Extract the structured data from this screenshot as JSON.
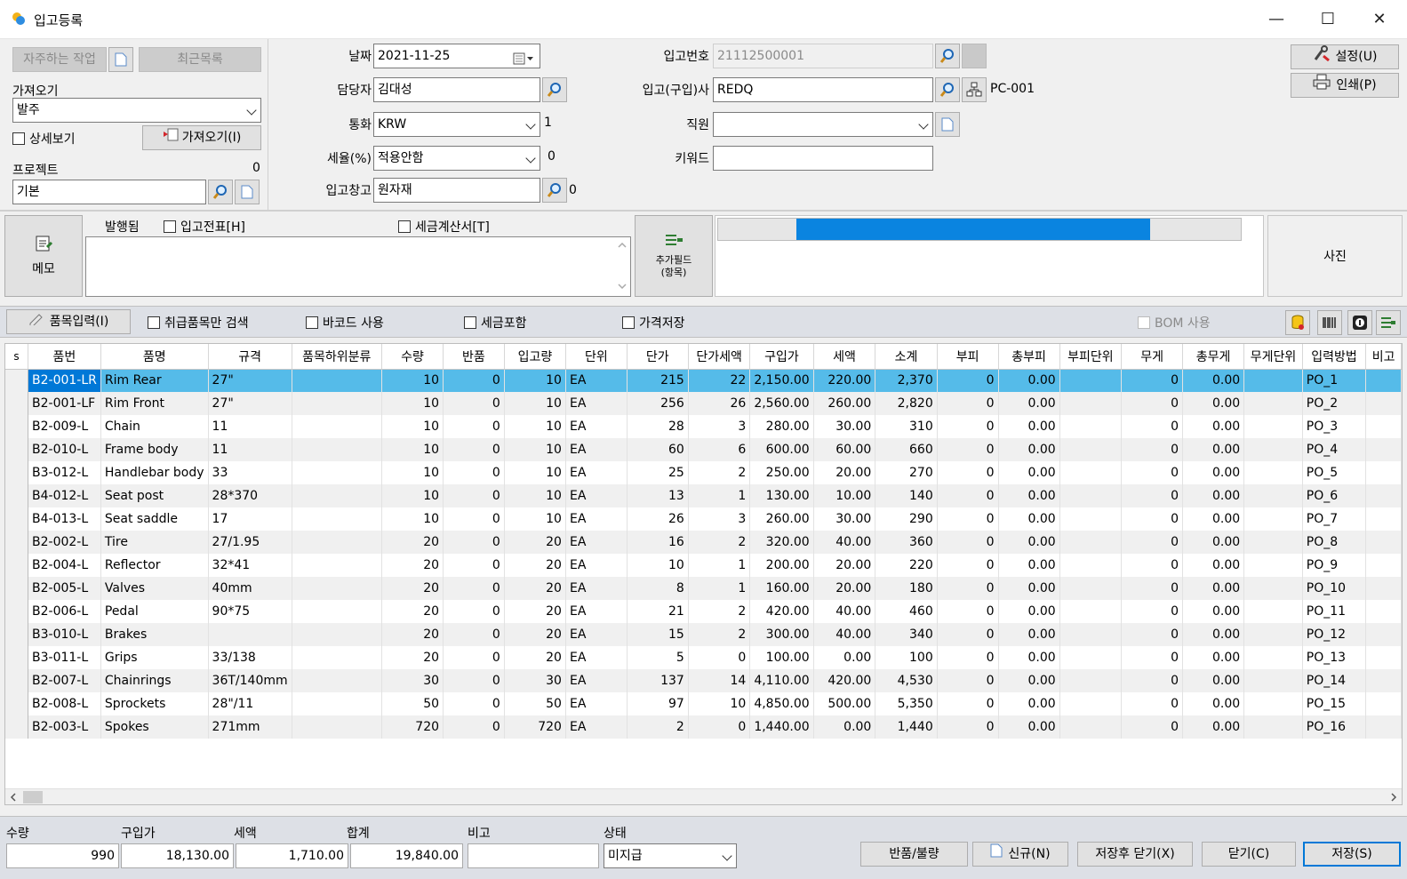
{
  "window": {
    "title": "입고등록",
    "minimize": "—",
    "maximize": "☐",
    "close": "✕"
  },
  "top_left": {
    "frequent_label": "자주하는 작업",
    "recent_label": "최근목록",
    "import_label": "가져오기",
    "import_value": "발주",
    "detail_view_label": "상세보기",
    "import_button_label": "가져오기(I)",
    "project_label": "프로젝트",
    "project_count": "0",
    "project_value": "기본"
  },
  "form": {
    "date_label": "날짜",
    "date_value": "2021-11-25",
    "manager_label": "담당자",
    "manager_value": "김대성",
    "currency_label": "통화",
    "currency_value": "KRW",
    "currency_rate": "1",
    "tax_label": "세율(%)",
    "tax_value": "적용안함",
    "tax_rate": "0",
    "warehouse_label": "입고창고",
    "warehouse_value": "원자재",
    "warehouse_count": "0",
    "receipt_no_label": "입고번호",
    "receipt_no_value": "21112500001",
    "supplier_label": "입고(구입)사",
    "supplier_value": "REDQ",
    "supplier_code": "PC-001",
    "staff_label": "직원",
    "staff_value": "",
    "keyword_label": "키워드",
    "keyword_value": ""
  },
  "right_buttons": {
    "settings_label": "설정(U)",
    "print_label": "인쇄(P)"
  },
  "memo": {
    "memo_label": "메모",
    "issued_label": "발행됨",
    "slip_label": "입고전표[H]",
    "invoice_label": "세금계산서[T]",
    "extra_field_label_1": "추가필드",
    "extra_field_label_2": "(항목)",
    "progress": 0.82,
    "photo_label": "사진"
  },
  "toolbar": {
    "item_input_label": "품목입력(I)",
    "handled_only_label": "취급품목만 검색",
    "barcode_label": "바코드 사용",
    "tax_included_label": "세금포함",
    "price_save_label": "가격저장",
    "bom_label": "BOM 사용"
  },
  "grid": {
    "columns": [
      "s",
      "품번",
      "품명",
      "규격",
      "품목하위분류",
      "수량",
      "반품",
      "입고량",
      "단위",
      "단가",
      "단가세액",
      "구입가",
      "세액",
      "소계",
      "부피",
      "총부피",
      "부피단위",
      "무게",
      "총무게",
      "무게단위",
      "입력방법",
      "비고"
    ],
    "rows": [
      [
        "B2-001-LR",
        "Rim Rear",
        "27\"",
        "",
        "10",
        "0",
        "10",
        "EA",
        "215",
        "22",
        "2,150.00",
        "220.00",
        "2,370",
        "0",
        "0.00",
        "",
        "0",
        "0.00",
        "",
        "PO_1"
      ],
      [
        "B2-001-LF",
        "Rim Front",
        "27\"",
        "",
        "10",
        "0",
        "10",
        "EA",
        "256",
        "26",
        "2,560.00",
        "260.00",
        "2,820",
        "0",
        "0.00",
        "",
        "0",
        "0.00",
        "",
        "PO_2"
      ],
      [
        "B2-009-L",
        "Chain",
        "11",
        "",
        "10",
        "0",
        "10",
        "EA",
        "28",
        "3",
        "280.00",
        "30.00",
        "310",
        "0",
        "0.00",
        "",
        "0",
        "0.00",
        "",
        "PO_3"
      ],
      [
        "B2-010-L",
        "Frame body",
        "11",
        "",
        "10",
        "0",
        "10",
        "EA",
        "60",
        "6",
        "600.00",
        "60.00",
        "660",
        "0",
        "0.00",
        "",
        "0",
        "0.00",
        "",
        "PO_4"
      ],
      [
        "B3-012-L",
        "Handlebar body",
        "33",
        "",
        "10",
        "0",
        "10",
        "EA",
        "25",
        "2",
        "250.00",
        "20.00",
        "270",
        "0",
        "0.00",
        "",
        "0",
        "0.00",
        "",
        "PO_5"
      ],
      [
        "B4-012-L",
        "Seat post",
        "28*370",
        "",
        "10",
        "0",
        "10",
        "EA",
        "13",
        "1",
        "130.00",
        "10.00",
        "140",
        "0",
        "0.00",
        "",
        "0",
        "0.00",
        "",
        "PO_6"
      ],
      [
        "B4-013-L",
        "Seat saddle",
        "17",
        "",
        "10",
        "0",
        "10",
        "EA",
        "26",
        "3",
        "260.00",
        "30.00",
        "290",
        "0",
        "0.00",
        "",
        "0",
        "0.00",
        "",
        "PO_7"
      ],
      [
        "B2-002-L",
        "Tire",
        "27/1.95",
        "",
        "20",
        "0",
        "20",
        "EA",
        "16",
        "2",
        "320.00",
        "40.00",
        "360",
        "0",
        "0.00",
        "",
        "0",
        "0.00",
        "",
        "PO_8"
      ],
      [
        "B2-004-L",
        "Reflector",
        "32*41",
        "",
        "20",
        "0",
        "20",
        "EA",
        "10",
        "1",
        "200.00",
        "20.00",
        "220",
        "0",
        "0.00",
        "",
        "0",
        "0.00",
        "",
        "PO_9"
      ],
      [
        "B2-005-L",
        "Valves",
        "40mm",
        "",
        "20",
        "0",
        "20",
        "EA",
        "8",
        "1",
        "160.00",
        "20.00",
        "180",
        "0",
        "0.00",
        "",
        "0",
        "0.00",
        "",
        "PO_10"
      ],
      [
        "B2-006-L",
        "Pedal",
        "90*75",
        "",
        "20",
        "0",
        "20",
        "EA",
        "21",
        "2",
        "420.00",
        "40.00",
        "460",
        "0",
        "0.00",
        "",
        "0",
        "0.00",
        "",
        "PO_11"
      ],
      [
        "B3-010-L",
        "Brakes",
        "",
        "",
        "20",
        "0",
        "20",
        "EA",
        "15",
        "2",
        "300.00",
        "40.00",
        "340",
        "0",
        "0.00",
        "",
        "0",
        "0.00",
        "",
        "PO_12"
      ],
      [
        "B3-011-L",
        "Grips",
        "33/138",
        "",
        "20",
        "0",
        "20",
        "EA",
        "5",
        "0",
        "100.00",
        "0.00",
        "100",
        "0",
        "0.00",
        "",
        "0",
        "0.00",
        "",
        "PO_13"
      ],
      [
        "B2-007-L",
        "Chainrings",
        "36T/140mm",
        "",
        "30",
        "0",
        "30",
        "EA",
        "137",
        "14",
        "4,110.00",
        "420.00",
        "4,530",
        "0",
        "0.00",
        "",
        "0",
        "0.00",
        "",
        "PO_14"
      ],
      [
        "B2-008-L",
        "Sprockets",
        "28\"/11",
        "",
        "50",
        "0",
        "50",
        "EA",
        "97",
        "10",
        "4,850.00",
        "500.00",
        "5,350",
        "0",
        "0.00",
        "",
        "0",
        "0.00",
        "",
        "PO_15"
      ],
      [
        "B2-003-L",
        "Spokes",
        "271mm",
        "",
        "720",
        "0",
        "720",
        "EA",
        "2",
        "0",
        "1,440.00",
        "0.00",
        "1,440",
        "0",
        "0.00",
        "",
        "0",
        "0.00",
        "",
        "PO_16"
      ]
    ]
  },
  "footer": {
    "qty_label": "수량",
    "qty_value": "990",
    "price_label": "구입가",
    "price_value": "18,130.00",
    "tax_label": "세액",
    "tax_value": "1,710.00",
    "total_label": "합계",
    "total_value": "19,840.00",
    "note_label": "비고",
    "note_value": "",
    "status_label": "상태",
    "status_value": "미지급",
    "return_label": "반품/불량",
    "new_label": "신규(N)",
    "save_close_label": "저장후 닫기(X)",
    "close_label": "닫기(C)",
    "save_label": "저장(S)"
  },
  "colors": {
    "selection": "#55bbe9",
    "selection_focus": "#0078d7",
    "progress": "#0a84e0"
  }
}
